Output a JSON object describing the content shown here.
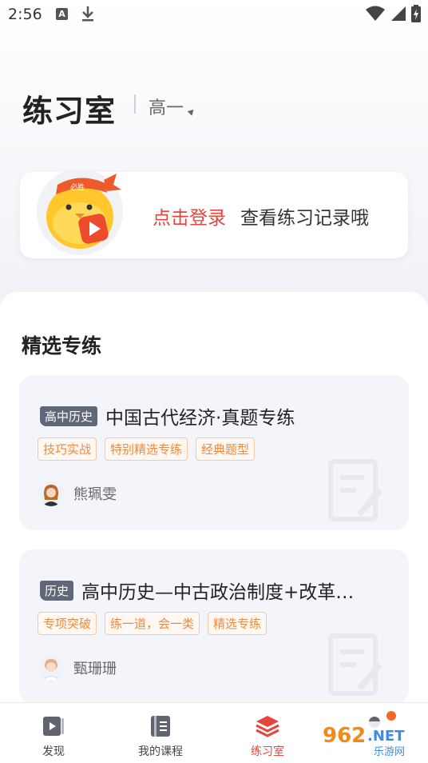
{
  "status_bar": {
    "time": "2:56",
    "notif_icon_letter": "A",
    "icons": [
      "notification-a-icon",
      "download-icon",
      "wifi-icon",
      "signal-icon",
      "battery-icon"
    ]
  },
  "header": {
    "title": "练习室",
    "grade": "高一"
  },
  "login_card": {
    "login_link": "点击登录",
    "hint": "查看练习记录哦",
    "mascot_band_text": "必胜"
  },
  "section": {
    "title": "精选专练"
  },
  "courses": [
    {
      "badge": "高中历史",
      "title": "中国古代经济·真题专练",
      "tags": [
        "技巧实战",
        "特别精选专练",
        "经典题型"
      ],
      "teacher": "熊珮雯"
    },
    {
      "badge": "历史",
      "title": "高中历史—中古政治制度+改革…",
      "tags": [
        "专项突破",
        "练一道，会一类",
        "精选专练"
      ],
      "teacher": "甄珊珊"
    }
  ],
  "bottom_nav": {
    "items": [
      {
        "label": "发现",
        "icon": "play-video-icon",
        "active": false
      },
      {
        "label": "我的课程",
        "icon": "notebook-icon",
        "active": false
      },
      {
        "label": "练习室",
        "icon": "layers-icon",
        "active": true
      },
      {
        "label": "",
        "icon": "profile-icon",
        "active": false
      }
    ]
  },
  "watermark": {
    "brand": "962",
    "suffix": ".NET",
    "subtitle": "乐游网"
  },
  "colors": {
    "accent": "#e6453c",
    "tag_orange": "#ef8a3a",
    "badge_gray": "#5f6878",
    "card_bg": "#f4f5fa"
  }
}
